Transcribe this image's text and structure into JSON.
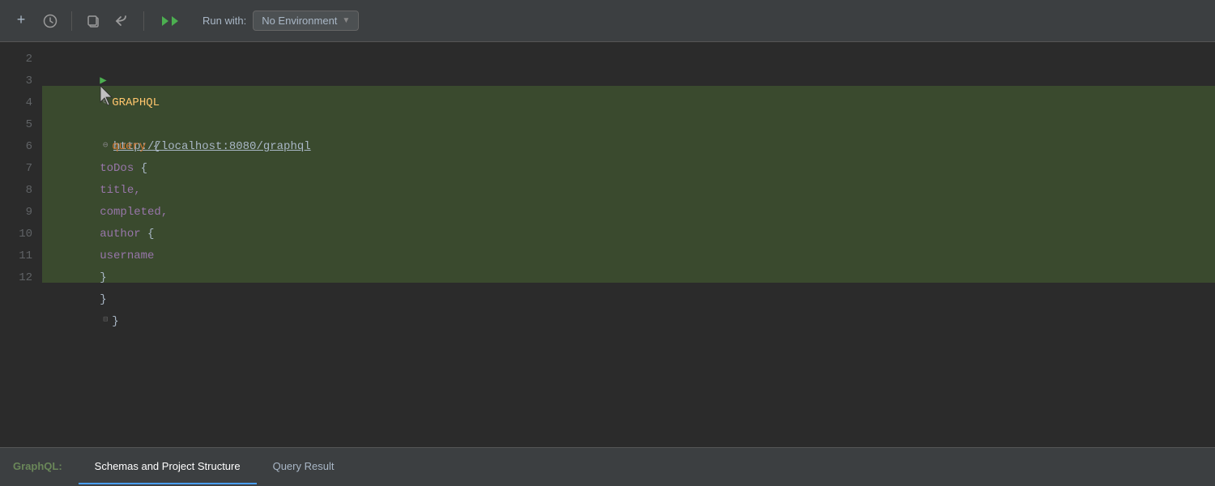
{
  "toolbar": {
    "add_icon": "+",
    "history_icon": "⊙",
    "copy_icon": "❐",
    "nav_icon": "↩",
    "run_icon": "▶▶",
    "run_with_label": "Run with:",
    "env_dropdown_value": "No Environment",
    "env_dropdown_chevron": "▼"
  },
  "editor": {
    "lines": [
      {
        "num": "2",
        "content_type": "graphql_header"
      },
      {
        "num": "3",
        "content_type": "empty"
      },
      {
        "num": "4",
        "content_type": "query_start"
      },
      {
        "num": "5",
        "content_type": "todos_start"
      },
      {
        "num": "6",
        "content_type": "title"
      },
      {
        "num": "7",
        "content_type": "completed"
      },
      {
        "num": "8",
        "content_type": "author_start"
      },
      {
        "num": "9",
        "content_type": "username"
      },
      {
        "num": "10",
        "content_type": "author_end"
      },
      {
        "num": "11",
        "content_type": "todos_end"
      },
      {
        "num": "12",
        "content_type": "query_end"
      }
    ],
    "graphql_keyword": "GRAPHQL",
    "graphql_url": "http://localhost:8080/graphql",
    "query_keyword": "query",
    "todos_field": "toDos",
    "title_field": "title,",
    "completed_field": "completed,",
    "author_field": "author",
    "username_field": "username"
  },
  "bottom_tabs": {
    "graphql_label": "GraphQL:",
    "schemas_tab": "Schemas and Project Structure",
    "query_result_tab": "Query Result"
  }
}
